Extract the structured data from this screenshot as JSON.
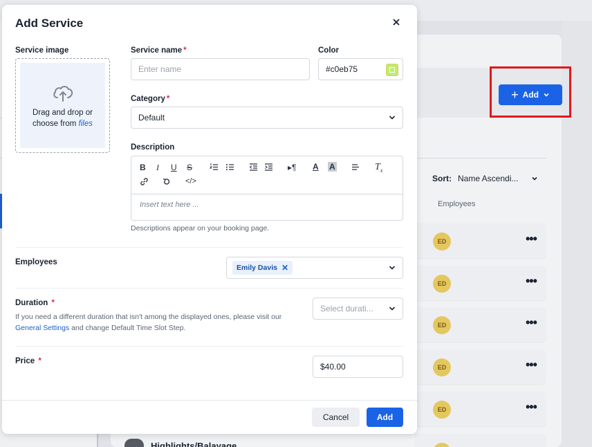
{
  "background": {
    "add_button_label": "Add",
    "sort_label": "Sort:",
    "sort_value": "Name Ascendi...",
    "employees_column": "Employees",
    "rows": [
      {
        "avatar": "ED"
      },
      {
        "avatar": "ED"
      },
      {
        "avatar": "ED"
      },
      {
        "avatar": "ED"
      },
      {
        "avatar": "ED"
      },
      {
        "avatar": "ED"
      }
    ],
    "bottom_item_text": "Highlights/Balayage",
    "accent_color": "#1a63e6",
    "highlight_color": "#e0181b"
  },
  "modal": {
    "title": "Add Service",
    "close_icon": "close-icon",
    "service_image": {
      "label": "Service image",
      "drop_text": "Drag and drop or choose from",
      "files_link": "files"
    },
    "service_name": {
      "label": "Service name",
      "required": "*",
      "placeholder": "Enter name"
    },
    "color": {
      "label": "Color",
      "value": "#c0eb75"
    },
    "category": {
      "label": "Category",
      "required": "*",
      "value": "Default"
    },
    "description": {
      "label": "Description",
      "placeholder": "Insert text here ...",
      "help": "Descriptions appear on your booking page.",
      "toolbar": [
        "bold-icon",
        "italic-icon",
        "underline-icon",
        "strikethrough-icon",
        "ordered-list-icon",
        "bullet-list-icon",
        "outdent-icon",
        "indent-icon",
        "paragraph-direction-icon",
        "text-color-icon",
        "background-color-icon",
        "align-icon",
        "clear-format-icon",
        "link-icon",
        "undo-icon",
        "code-icon"
      ]
    },
    "employees": {
      "label": "Employees",
      "selected": "Emily Davis"
    },
    "duration": {
      "label": "Duration",
      "required": "*",
      "help_prefix": "If you need a different duration that isn't among the displayed ones, please visit our",
      "help_link": "General Settings",
      "help_suffix": "and change Default Time Slot Step.",
      "placeholder": "Select durati..."
    },
    "price": {
      "label": "Price",
      "required": "*",
      "value": "$40.00"
    },
    "cancel_label": "Cancel",
    "add_label": "Add"
  }
}
